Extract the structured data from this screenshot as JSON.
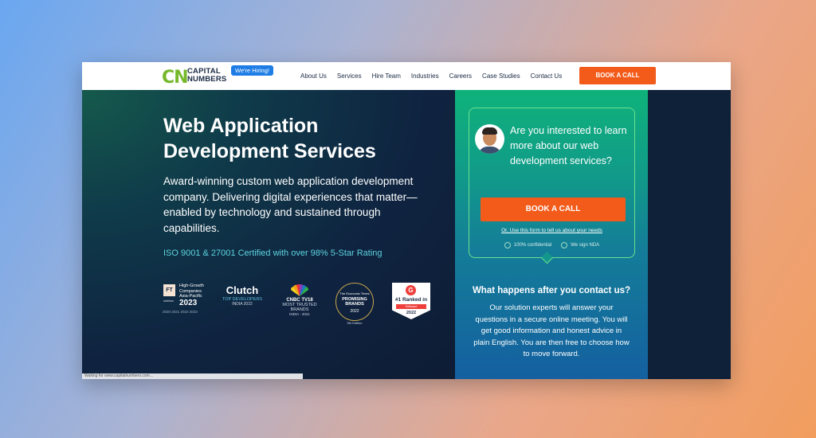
{
  "header": {
    "logo_mark": "CN",
    "logo_line1": "CAPITAL",
    "logo_line2": "NUMBERS",
    "hiring_badge": "We're Hiring!",
    "nav": [
      "About Us",
      "Services",
      "Hire Team",
      "Industries",
      "Careers",
      "Case Studies",
      "Contact Us"
    ],
    "book_call": "BOOK A CALL"
  },
  "hero": {
    "title": "Web Application Development Services",
    "description": "Award-winning custom web application development company. Delivering digital experiences that matter— enabled by technology and sustained through capabilities.",
    "certification": "ISO 9001 & 27001 Certified with over 98% 5-Star Rating"
  },
  "badges": {
    "ft": {
      "mark": "FT",
      "line1": "High-Growth",
      "line2": "Companies",
      "line3": "Asia-Pacific",
      "small": "statista",
      "year": "2023",
      "years": "2020  2021  2022  2023"
    },
    "clutch": {
      "name": "Clutch",
      "line1": "TOP DEVELOPERS",
      "line2": "INDIA 2022"
    },
    "cnbc": {
      "name": "CNBC",
      "tv": "TV18",
      "line1": "MOST TRUSTED",
      "line2": "BRANDS",
      "line3": "INDIA - 2021"
    },
    "promising": {
      "line0": "The Economic Times",
      "line1": "PROMISING",
      "line2": "BRANDS",
      "year": "2022",
      "edition": "5th Edition"
    },
    "g2": {
      "logo": "G",
      "rank": "#1 Ranked in",
      "category": "Software Development",
      "year": "2022"
    }
  },
  "contact": {
    "question": "Are you interested to learn more about our web development services?",
    "book_call": "BOOK A CALL",
    "form_link": "Or, Use this form to tell us about your needs",
    "check1": "100% confidential",
    "check2": "We sign NDA",
    "after_title": "What happens after you contact us?",
    "after_text": "Our solution experts will answer your questions in a secure online meeting. You will get good information and honest advice in plain English. You are then free to choose how to move forward."
  },
  "status_bar": "Waiting for www.capitalnumbers.com..."
}
